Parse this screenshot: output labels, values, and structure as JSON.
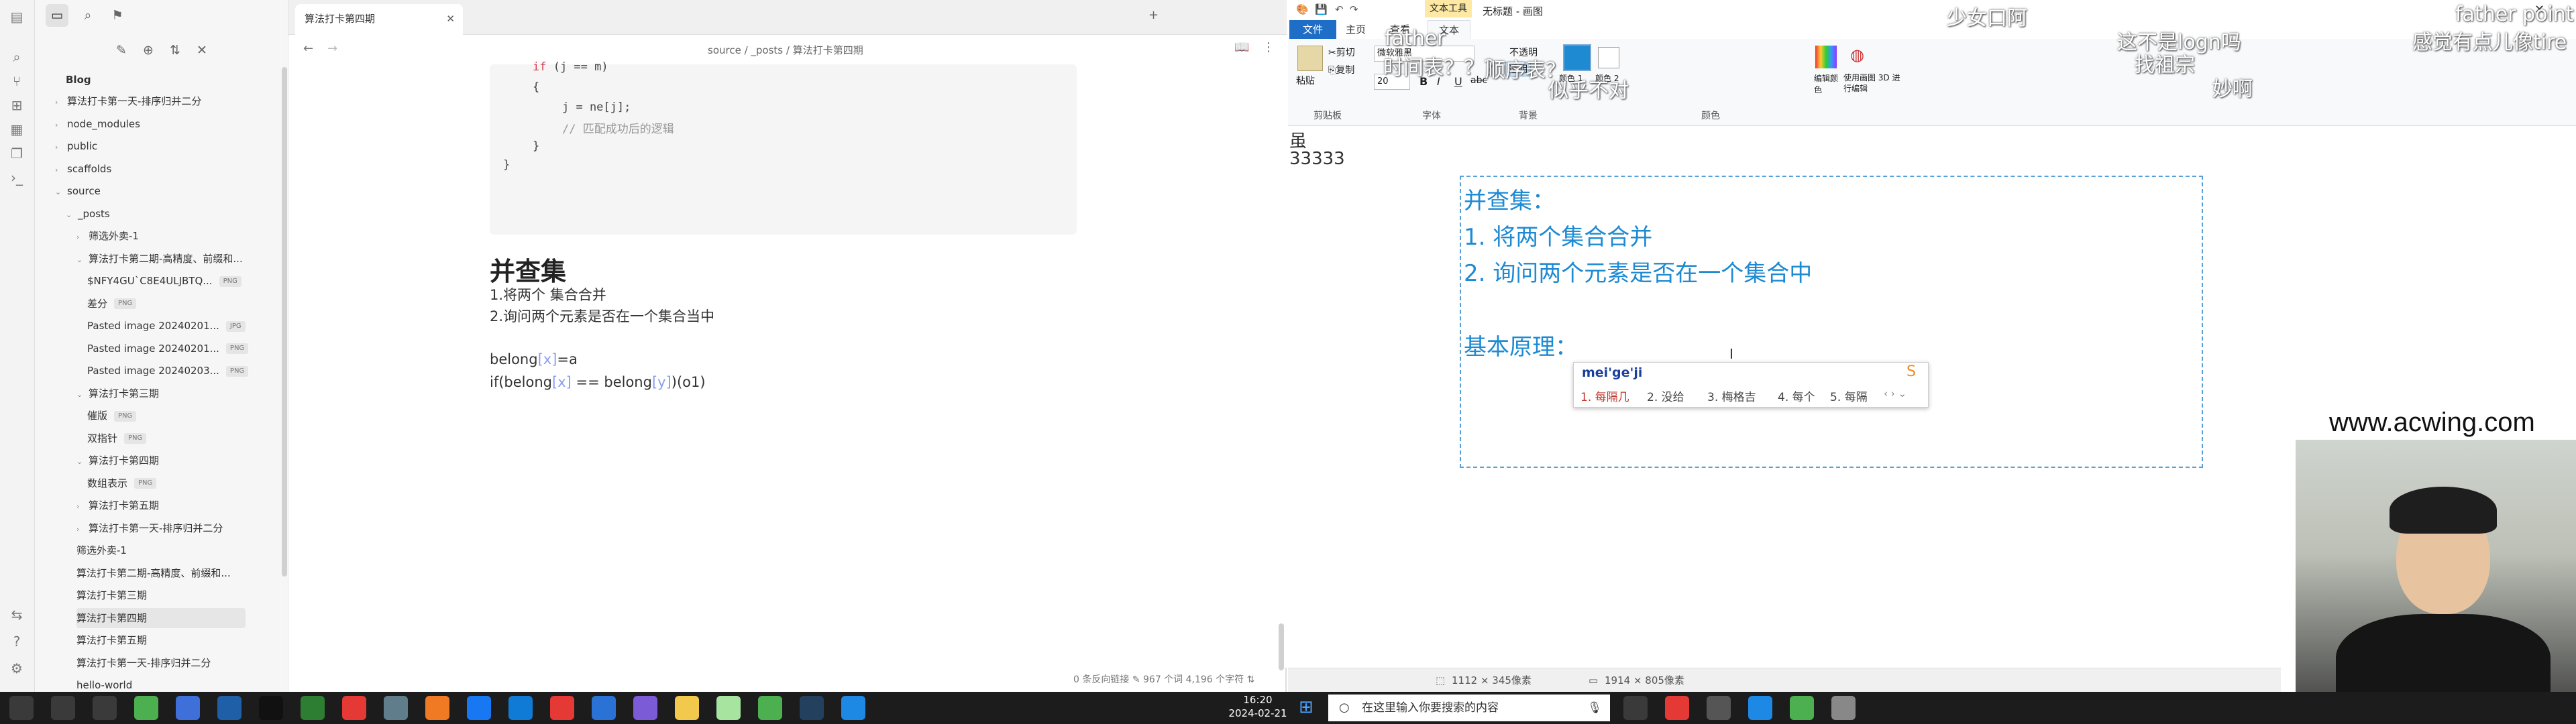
{
  "obsidian": {
    "vault_name": "Blog",
    "tab_title": "算法打卡第四期",
    "breadcrumb": [
      "source",
      "_posts",
      "算法打卡第四期"
    ],
    "tree": [
      {
        "label": "算法打卡第一天-排序归并二分",
        "type": "folder-collapsed"
      },
      {
        "label": "node_modules",
        "type": "folder-collapsed"
      },
      {
        "label": "public",
        "type": "folder-collapsed"
      },
      {
        "label": "scaffolds",
        "type": "folder-collapsed"
      },
      {
        "label": "source",
        "type": "folder-open"
      },
      {
        "label": "_posts",
        "type": "folder-open"
      },
      {
        "label": "筛选外卖-1",
        "type": "folder-collapsed"
      },
      {
        "label": "算法打卡第二期-高精度、前缀和...",
        "type": "folder-open"
      },
      {
        "label": "$NFY4GU`C8E4ULJBTQ...",
        "type": "file",
        "badge": "PNG"
      },
      {
        "label": "差分",
        "type": "file",
        "badge": "PNG"
      },
      {
        "label": "Pasted image 20240201...",
        "type": "file",
        "badge": "JPG"
      },
      {
        "label": "Pasted image 20240201...",
        "type": "file",
        "badge": "PNG"
      },
      {
        "label": "Pasted image 20240203...",
        "type": "file",
        "badge": "PNG"
      },
      {
        "label": "算法打卡第三期",
        "type": "folder-open"
      },
      {
        "label": "催版",
        "type": "file",
        "badge": "PNG"
      },
      {
        "label": "双指针",
        "type": "file",
        "badge": "PNG"
      },
      {
        "label": "算法打卡第四期",
        "type": "folder-open"
      },
      {
        "label": "数组表示",
        "type": "file",
        "badge": "PNG"
      },
      {
        "label": "算法打卡第五期",
        "type": "folder-collapsed"
      },
      {
        "label": "算法打卡第一天-排序归并二分",
        "type": "folder-collapsed"
      },
      {
        "label": "筛选外卖-1",
        "type": "note"
      },
      {
        "label": "算法打卡第二期-高精度、前缀和...",
        "type": "note"
      },
      {
        "label": "算法打卡第三期",
        "type": "note"
      },
      {
        "label": "算法打卡第四期",
        "type": "note",
        "selected": true
      },
      {
        "label": "算法打卡第五期",
        "type": "note"
      },
      {
        "label": "算法打卡第一天-排序归并二分",
        "type": "note"
      },
      {
        "label": "hello-world",
        "type": "note"
      }
    ],
    "code_lines": [
      {
        "kw": "if",
        "rest": " (j == m)"
      },
      {
        "kw": "",
        "rest": "{"
      },
      {
        "kw": "",
        "rest": "j = ne[j];"
      },
      {
        "kw": "",
        "rest": "// 匹配成功后的逻辑"
      },
      {
        "kw": "",
        "rest": "}"
      },
      {
        "kw": "",
        "rest": "}"
      }
    ],
    "heading": "并查集",
    "para_lines": [
      "1.将两个 集合合并",
      "2.询问两个元素是否在一个集合当中"
    ],
    "code_text_1": {
      "pre": "belong",
      "b1": "[x]",
      "post": "=a"
    },
    "code_text_2": {
      "pre": "if(belong",
      "b1": "[x]",
      "mid": " == belong",
      "b2": "[y]",
      "post": ")(o1)"
    },
    "status": {
      "backlinks": "0 条反向链接",
      "words": "967 个词",
      "chars": "4,196 个字符"
    }
  },
  "paint": {
    "window_title": "无标题 - 画图",
    "tabs": {
      "file": "文件",
      "home": "主页",
      "view": "查看",
      "text_tools": "文本工具",
      "text": "文本"
    },
    "clipboard": {
      "paste": "粘贴",
      "cut": "剪切",
      "copy": "复制",
      "group": "剪贴板"
    },
    "font": {
      "name": "微软雅黑",
      "size": "20",
      "group": "字体"
    },
    "background": {
      "opaque": "不透明",
      "transparent": "透明",
      "group": "背景"
    },
    "colors": {
      "c1": "颜色 1",
      "c2": "颜色 2",
      "edit": "编辑颜色",
      "paint3d": "使用画图 3D 进行编辑",
      "group": "颜色"
    },
    "canvas_corner_text": [
      "虽",
      "33333"
    ],
    "text_lines": [
      "并查集：",
      "1. 将两个集合合并",
      "2. 询问两个元素是否在一个集合中",
      "基本原理："
    ],
    "ime": {
      "input": "mei'ge'ji",
      "candidates": [
        "1. 每隔几",
        "2. 没给",
        "3. 梅格吉",
        "4. 每个",
        "5. 每隔"
      ]
    },
    "status": {
      "selection": "1112 × 345像素",
      "canvas": "1914 × 805像素"
    },
    "watermark": "www.acwing.com"
  },
  "danmaku": [
    "father",
    "少女口阿",
    "father point",
    "感觉有点儿像tire",
    "这不是logn吗",
    "找祖宗",
    "妙啊",
    "时间表？？？",
    "顺序表？",
    "似乎不对"
  ],
  "taskbar": {
    "search_placeholder": "在这里输入你要搜索的内容",
    "time": "16:20",
    "date": "2024-02-21"
  }
}
